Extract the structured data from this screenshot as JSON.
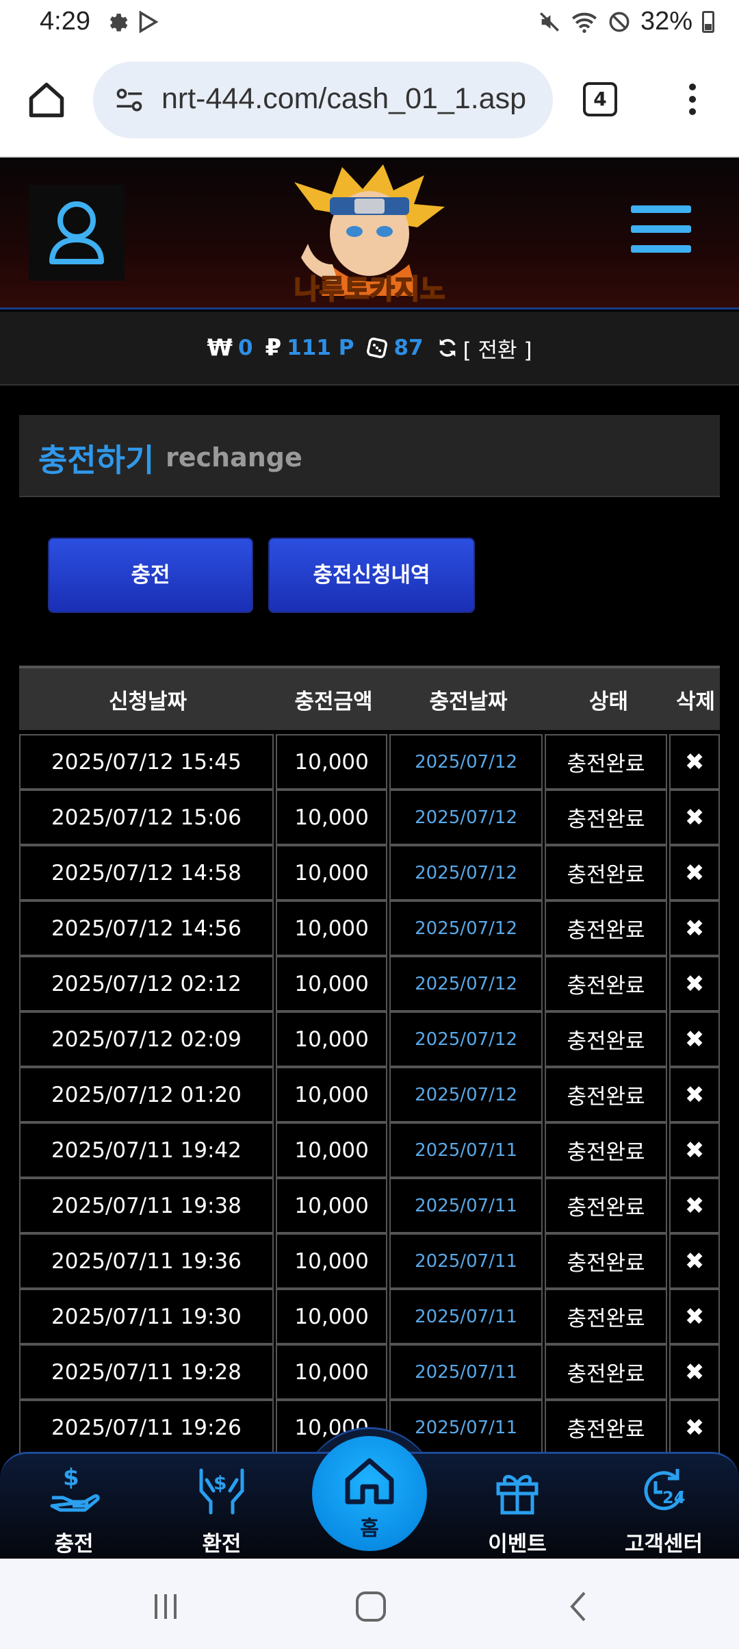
{
  "status_bar": {
    "time": "4:29",
    "battery": "32%"
  },
  "browser": {
    "url": "nrt-444.com/cash_01_1.asp",
    "tab_count": "4"
  },
  "site": {
    "logo_text": "나루토카지노"
  },
  "balance": {
    "won_value": "0",
    "point_value": "111 P",
    "chip_value": "87",
    "switch_label": "[ 전환 ]"
  },
  "page": {
    "title_ko": "충전하기",
    "title_en": "rechange"
  },
  "buttons": {
    "charge": "충전",
    "history": "충전신청내역"
  },
  "table": {
    "headers": [
      "신청날짜",
      "충전금액",
      "충전날짜",
      "상태",
      "삭제"
    ],
    "rows": [
      {
        "request": "2025/07/12 15:45",
        "amount": "10,000",
        "charged": "2025/07/12",
        "status": "충전완료",
        "del": "✖"
      },
      {
        "request": "2025/07/12 15:06",
        "amount": "10,000",
        "charged": "2025/07/12",
        "status": "충전완료",
        "del": "✖"
      },
      {
        "request": "2025/07/12 14:58",
        "amount": "10,000",
        "charged": "2025/07/12",
        "status": "충전완료",
        "del": "✖"
      },
      {
        "request": "2025/07/12 14:56",
        "amount": "10,000",
        "charged": "2025/07/12",
        "status": "충전완료",
        "del": "✖"
      },
      {
        "request": "2025/07/12 02:12",
        "amount": "10,000",
        "charged": "2025/07/12",
        "status": "충전완료",
        "del": "✖"
      },
      {
        "request": "2025/07/12 02:09",
        "amount": "10,000",
        "charged": "2025/07/12",
        "status": "충전완료",
        "del": "✖"
      },
      {
        "request": "2025/07/12 01:20",
        "amount": "10,000",
        "charged": "2025/07/12",
        "status": "충전완료",
        "del": "✖"
      },
      {
        "request": "2025/07/11 19:42",
        "amount": "10,000",
        "charged": "2025/07/11",
        "status": "충전완료",
        "del": "✖"
      },
      {
        "request": "2025/07/11 19:38",
        "amount": "10,000",
        "charged": "2025/07/11",
        "status": "충전완료",
        "del": "✖"
      },
      {
        "request": "2025/07/11 19:36",
        "amount": "10,000",
        "charged": "2025/07/11",
        "status": "충전완료",
        "del": "✖"
      },
      {
        "request": "2025/07/11 19:30",
        "amount": "10,000",
        "charged": "2025/07/11",
        "status": "충전완료",
        "del": "✖"
      },
      {
        "request": "2025/07/11 19:28",
        "amount": "10,000",
        "charged": "2025/07/11",
        "status": "충전완료",
        "del": "✖"
      },
      {
        "request": "2025/07/11 19:26",
        "amount": "10,000",
        "charged": "2025/07/11",
        "status": "충전완료",
        "del": "✖"
      }
    ]
  },
  "bottom_nav": {
    "charge": "충전",
    "exchange": "환전",
    "home": "홈",
    "event": "이벤트",
    "support": "고객센터"
  },
  "colors": {
    "accent_blue": "#3098ea",
    "date_blue": "#5aa9e8",
    "button_blue": "#2c4fe0",
    "home_circle": "#0a8ee6"
  }
}
